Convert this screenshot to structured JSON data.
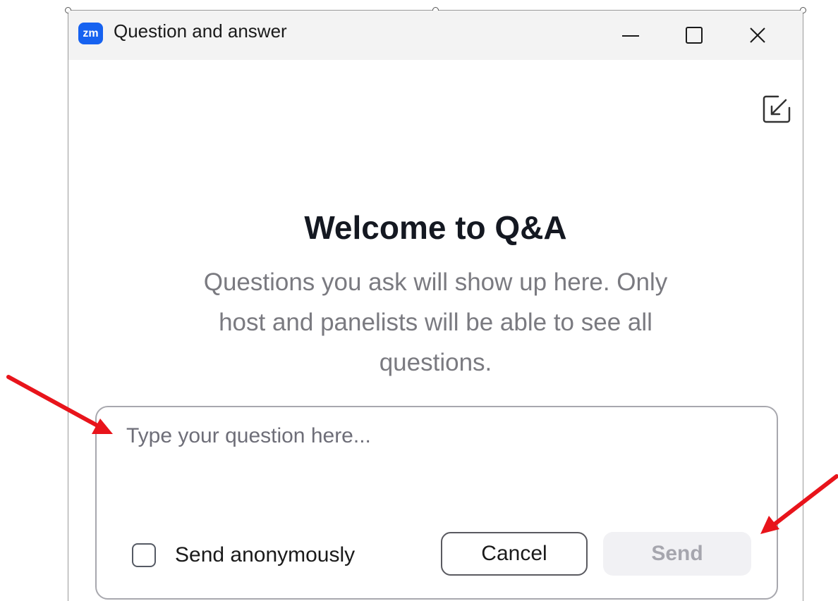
{
  "window": {
    "title": "Question and answer",
    "logo_text": "zm",
    "controls": [
      "minimize-icon",
      "maximize-icon",
      "close-icon"
    ]
  },
  "header": {
    "collapse_icon": "collapse-arrow-icon"
  },
  "welcome": {
    "title": "Welcome to Q&A",
    "line1": "Questions you ask will show up here. Only",
    "line2": "host and panelists will be able to see all",
    "line3": "questions."
  },
  "composer": {
    "placeholder": "Type your question here...",
    "value": "",
    "anonymous_label": "Send anonymously",
    "anonymous_checked": false,
    "cancel_label": "Cancel",
    "send_label": "Send",
    "send_enabled": false
  },
  "colors": {
    "brand": "#1662f0",
    "annotation_arrow": "#e8141b",
    "title_text": "#141821",
    "muted_text": "#7a7a80",
    "send_disabled_bg": "#f1f1f4"
  }
}
